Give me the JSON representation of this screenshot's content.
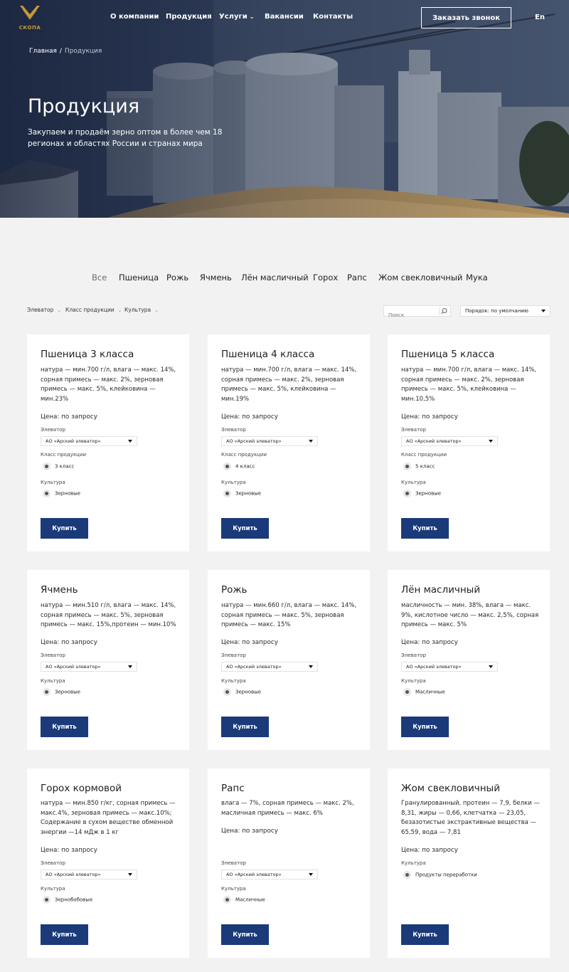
{
  "header": {
    "logo_text": "СКОПА",
    "nav": [
      "О компании",
      "Продукция",
      "Услуги",
      "Вакансии",
      "Контакты"
    ],
    "call_button": "Заказать звонок",
    "lang": "En"
  },
  "breadcrumb": {
    "home": "Главная",
    "sep": "/",
    "current": "Продукция"
  },
  "hero": {
    "title": "Продукция",
    "subtitle": "Закупаем и продаём зерно оптом в более чем 18 регионах и областях России и странах мира"
  },
  "tabs": [
    "Все",
    "Пшеница",
    "Рожь",
    "Ячмень",
    "Лён масличный",
    "Горох",
    "Рапс",
    "Жом свекловичный",
    "Мука"
  ],
  "filters": {
    "elevator": "Элеватор",
    "product_class": "Класс продукции",
    "culture": "Культура",
    "search_placeholder": "Поиск",
    "sort": "Порядок: по умолчанию"
  },
  "labels": {
    "elevator": "Элеватор",
    "class": "Класс продукции",
    "culture": "Культура",
    "buy": "Купить"
  },
  "products": [
    {
      "title": "Пшеница 3 класса",
      "desc": "натура — мин.700 г/л, влага — макс. 14%, сорная примесь — макс. 2%, зерновая примесь — макс. 5%, клейковина — мин.23%",
      "price": "Цена: по запросу",
      "elevator": "АО «Арский элеватор»",
      "class": "3 класс",
      "culture": "Зерновые"
    },
    {
      "title": "Пшеница 4 класса",
      "desc": "натура — мин.700 г/л, влага — макс. 14%, сорная примесь — макс. 2%, зерновая примесь — макс. 5%, клейковина — мин.19%",
      "price": "Цена: по запросу",
      "elevator": "АО «Арский элеватор»",
      "class": "4 класс",
      "culture": "Зерновые"
    },
    {
      "title": "Пшеница 5 класса",
      "desc": "натура — мин.700 г/л, влага — макс. 14%, сорная примесь — макс. 2%, зерновая примесь — макс. 5%, клейковина — мин.10,5%",
      "price": "Цена: по запросу",
      "elevator": "АО «Арский элеватор»",
      "class": "5 класс",
      "culture": "Зерновые"
    },
    {
      "title": "Ячмень",
      "desc": "натура — мин.510 г/л, влага — макс. 14%, сорная примесь — макс. 5%, зерновая примесь — макс. 15%,протеин — мин.10%",
      "price": "Цена: по запросу",
      "elevator": "АО «Арский элеватор»",
      "culture": "Зерновые"
    },
    {
      "title": "Рожь",
      "desc": "натура — мин.660 г/л, влага — макс. 14%, сорная примесь — макс. 5%, зерновая примесь — макс. 15%",
      "price": "Цена: по запросу",
      "elevator": "АО «Арский элеватор»",
      "culture": "Зерновые"
    },
    {
      "title": "Лён масличный",
      "desc": "масличность — мин. 38%, влага — макс. 9%, кислотное число — макс. 2,5%, сорная примесь — макс. 5%",
      "price": "Цена: по запросу",
      "elevator": "АО «Арский элеватор»",
      "culture": "Масличные"
    },
    {
      "title": "Горох кормовой",
      "desc": "натура — мин.850 г/кг, сорная примесь — макс.4%, зерновая примесь — макс.10%; Содержание в сухом веществе обменной энергии —14 мДж в 1 кг",
      "price": "Цена: по запросу",
      "elevator": "АО «Арский элеватор»",
      "culture": "Зернобобовые"
    },
    {
      "title": "Рапс",
      "desc": "влага — 7%, сорная примесь — макс. 2%, масличная примесь — макс. 6%",
      "price": "Цена: по запросу",
      "elevator": "АО «Арский элеватор»",
      "culture": "Масличные"
    },
    {
      "title": "Жом свекловичный",
      "desc": "Гранулированный, протеин — 7,9, белки — 8,31, жиры — 0,66, клетчатка — 23,05, безазотистые экстрактивные вещества — 65,59, вода — 7,81",
      "price": "Цена: по запросу",
      "culture": "Продукты переработки"
    }
  ]
}
